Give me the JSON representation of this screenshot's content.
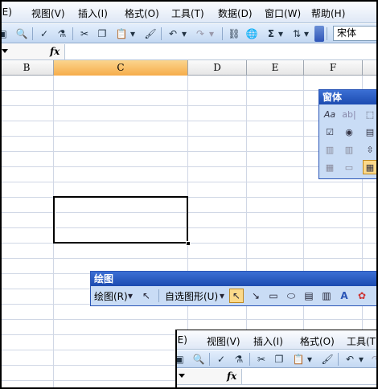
{
  "menu": [
    "(E)",
    "视图(V)",
    "插入(I)",
    "格式(O)",
    "工具(T)",
    "数据(D)",
    "窗口(W)",
    "帮助(H)"
  ],
  "toolbar": {
    "font_name": "宋体",
    "sum_symbol": "Σ"
  },
  "formula_bar": {
    "fx": "fx"
  },
  "columns": [
    "B",
    "C",
    "D",
    "E",
    "F"
  ],
  "selected_column": "C",
  "forms_toolbar": {
    "title": "窗体"
  },
  "drawing_toolbar": {
    "title": "绘图",
    "draw_menu": "绘图(R)",
    "autoshapes_menu": "自选图形(U)"
  },
  "second_window": {
    "menu": [
      "(E)",
      "视图(V)",
      "插入(I)",
      "格式(O)",
      "工具(T)"
    ],
    "fx": "fx"
  },
  "colors": {
    "title_blue": "#1c4bb0",
    "selected_header": "#f6ac4a",
    "toolbar": "#c3d8f2"
  }
}
